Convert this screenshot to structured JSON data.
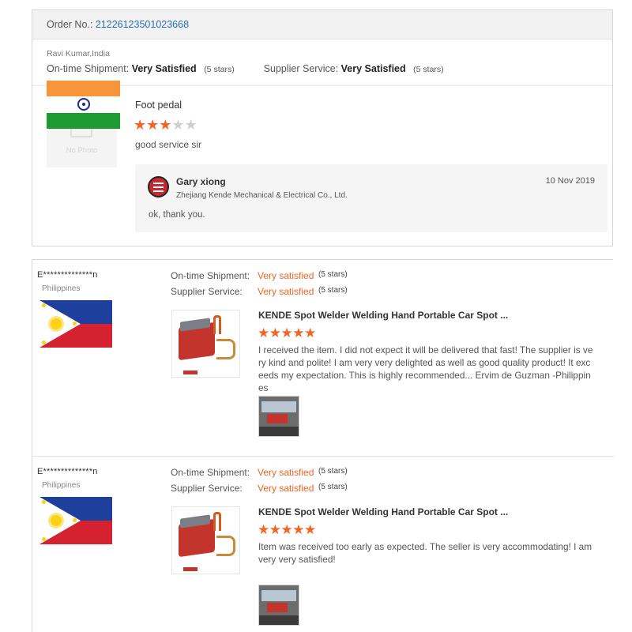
{
  "order": {
    "label": "Order No.:",
    "number": "21226123501023668",
    "buyer": "Ravi Kumar,India",
    "ontime_label": "On-time Shipment:",
    "ontime_value": "Very Satisfied",
    "ontime_stars": "(5 stars)",
    "supplier_label": "Supplier Service:",
    "supplier_value": "Very Satisfied",
    "supplier_stars": "(5 stars)",
    "no_photo": "No Photo",
    "product": "Foot pedal",
    "rating": 3,
    "comment": "good service sir",
    "reply": {
      "name": "Gary xiong",
      "company": "Zhejiang Kende Mechanical & Electrical Co., Ltd.",
      "date": "10 Nov 2019",
      "text": "ok, thank you."
    }
  },
  "reviews": [
    {
      "user": "E**************n",
      "country": "Philippines",
      "ontime_label": "On-time Shipment:",
      "ontime_value": "Very satisfied",
      "ontime_stars": "(5 stars)",
      "supplier_label": "Supplier Service:",
      "supplier_value": "Very satisfied",
      "supplier_stars": "(5 stars)",
      "title": "KENDE Spot Welder Welding Hand Portable Car Spot ...",
      "stars": "★★★★★",
      "text": "I received the item. I did not expect it will be delivered that fast! The supplier is very kind and polite! I am very very delighted as well as good quality product! It exceeds my expectation. This is highly recommended... Ervim de Guzman -Philippines"
    },
    {
      "user": "E**************n",
      "country": "Philippines",
      "ontime_label": "On-time Shipment:",
      "ontime_value": "Very satisfied",
      "ontime_stars": "(5 stars)",
      "supplier_label": "Supplier Service:",
      "supplier_value": "Very satisfied",
      "supplier_stars": "(5 stars)",
      "title": "KENDE Spot Welder Welding Hand Portable Car Spot ...",
      "stars": "★★★★★",
      "text": "Item was received too early as expected. The seller is very accommodating! I am very very satisfied!"
    }
  ],
  "colors": {
    "accent": "#f26522",
    "link": "#2a6ebb"
  }
}
